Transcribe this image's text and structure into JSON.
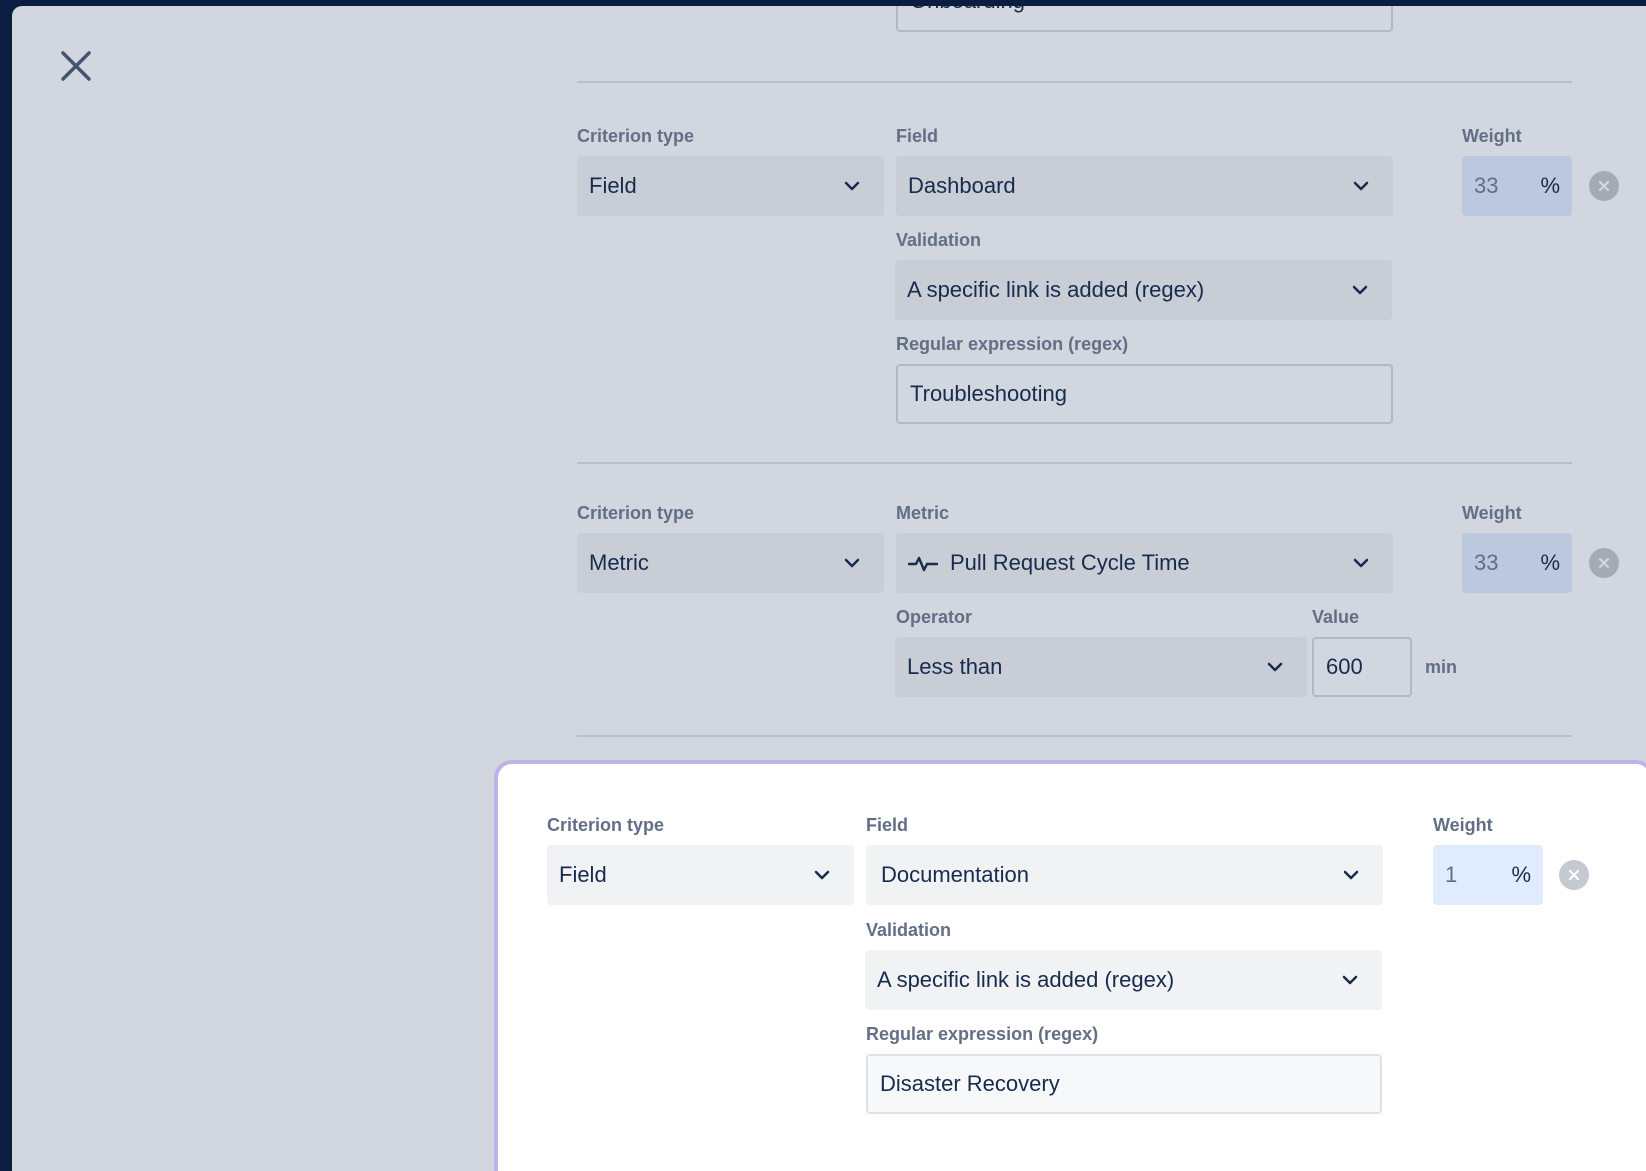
{
  "close_icon": "close-icon",
  "top_partial": {
    "value": "Onboarding"
  },
  "criteria": [
    {
      "criterion_type_label": "Criterion type",
      "criterion_type_value": "Field",
      "field_label": "Field",
      "field_value": "Dashboard",
      "weight_label": "Weight",
      "weight_value": "33",
      "weight_unit": "%",
      "validation_label": "Validation",
      "validation_value": "A specific link is added (regex)",
      "regex_label": "Regular expression (regex)",
      "regex_value": "Troubleshooting"
    },
    {
      "criterion_type_label": "Criterion type",
      "criterion_type_value": "Metric",
      "metric_label": "Metric",
      "metric_value": "Pull Request Cycle Time",
      "metric_icon": "activity-icon",
      "weight_label": "Weight",
      "weight_value": "33",
      "weight_unit": "%",
      "operator_label": "Operator",
      "operator_value": "Less than",
      "value_label": "Value",
      "value_value": "600",
      "value_unit": "min"
    },
    {
      "criterion_type_label": "Criterion type",
      "criterion_type_value": "Field",
      "field_label": "Field",
      "field_value": "Documentation",
      "weight_label": "Weight",
      "weight_value": "1",
      "weight_unit": "%",
      "validation_label": "Validation",
      "validation_value": "A specific link is added (regex)",
      "regex_label": "Regular expression (regex)",
      "regex_value": "Disaster Recovery"
    }
  ]
}
